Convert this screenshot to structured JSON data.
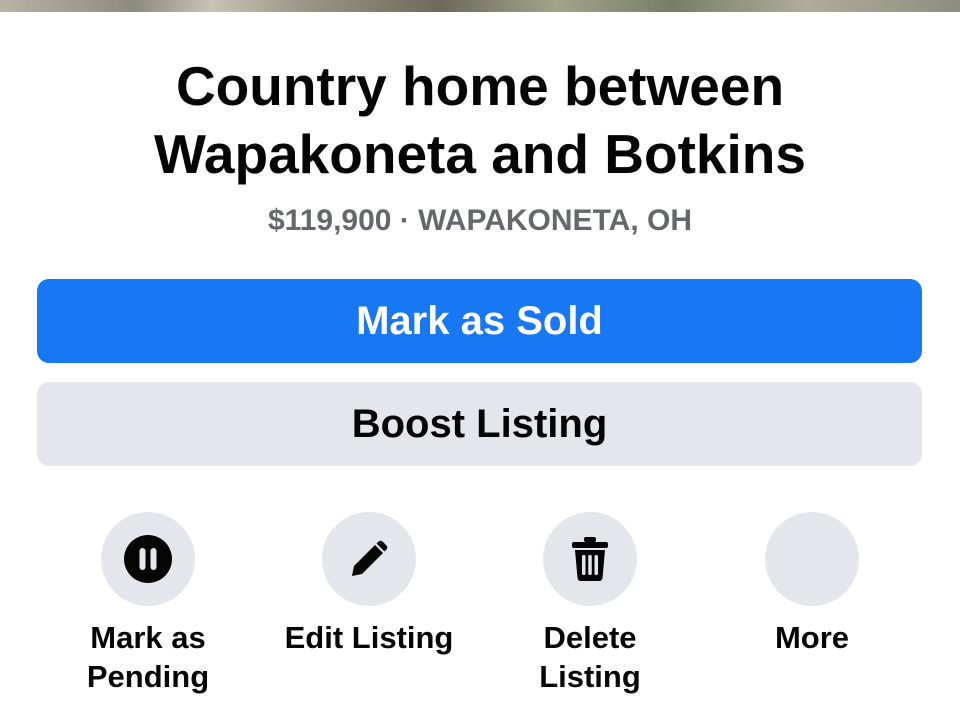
{
  "listing": {
    "title": "Country home between Wapakoneta and Botkins",
    "subtitle": "$119,900 · WAPAKONETA, OH"
  },
  "buttons": {
    "mark_sold": "Mark as Sold",
    "boost": "Boost Listing"
  },
  "actions": [
    {
      "label": "Mark as\nPending",
      "icon": "pause-icon"
    },
    {
      "label": "Edit Listing",
      "icon": "pencil-icon"
    },
    {
      "label": "Delete\nListing",
      "icon": "trash-icon"
    },
    {
      "label": "More",
      "icon": "more-icon"
    }
  ],
  "colors": {
    "primary": "#1877f2",
    "secondary_bg": "#e4e6eb",
    "text": "#050505",
    "muted_text": "#65676b"
  }
}
